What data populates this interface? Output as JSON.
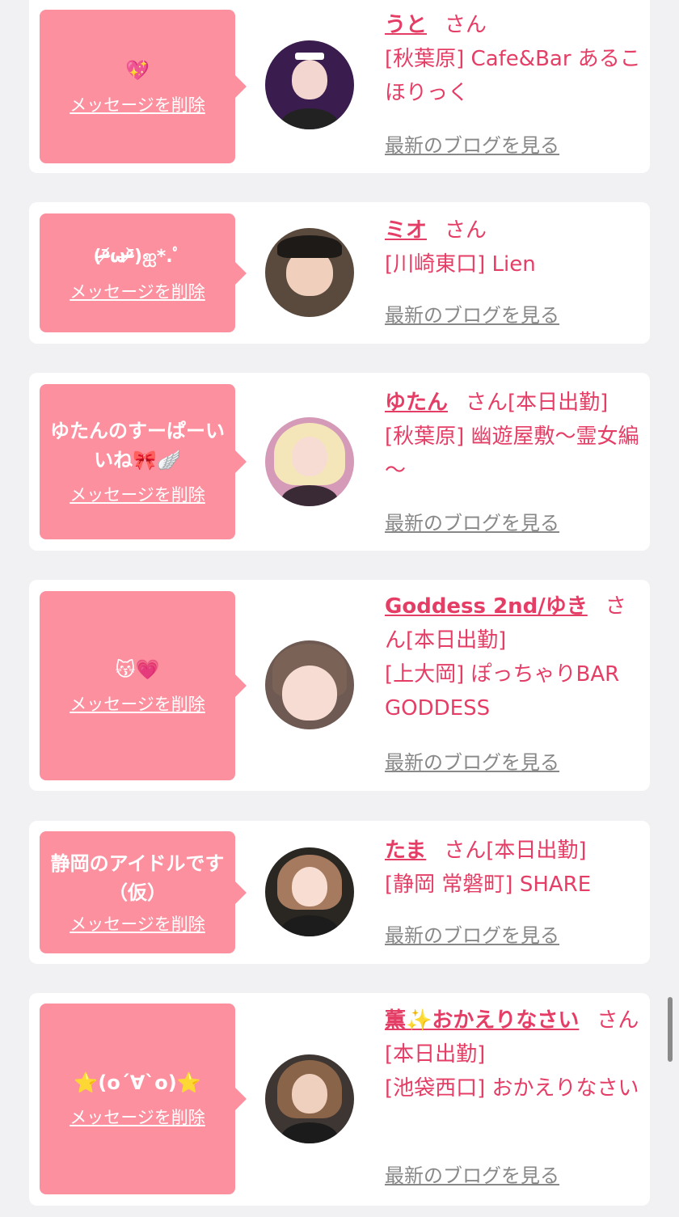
{
  "colors": {
    "accent": "#e53e66",
    "bubble": "#fc909f",
    "blog_link": "#888888",
    "background": "#f1f1f3"
  },
  "delete_label": "メッセージを削除",
  "blog_label": "最新のブログを見る",
  "san_label": "さん",
  "items": [
    {
      "message": "💖",
      "name": "うと",
      "status": "",
      "shop": "[秋葉原] Cafe&Bar あるこほりっく",
      "avatar_icon": "girl-maid-photo"
    },
    {
      "message": "(ᵒ̴̶̷᷄ωᵒ̴̶̷᷅)ஐ*.ﾟ",
      "name": "ミオ",
      "status": "",
      "shop": "[川崎東口] Lien",
      "avatar_icon": "girl-photo"
    },
    {
      "message": "ゆたんのすーぱーいいね🎀🪽",
      "name": "ゆたん",
      "status": "[本日出勤]",
      "shop": "[秋葉原] 幽遊屋敷～霊女編～",
      "avatar_icon": "girl-blonde-photo"
    },
    {
      "message": "😽💗",
      "name": "Goddess 2nd/ゆき",
      "status": "[本日出勤]",
      "shop": "[上大岡] ぽっちゃりBAR GODDESS",
      "avatar_icon": "girl-closeup-photo"
    },
    {
      "message": "静岡のアイドルです（仮）",
      "name": "たま",
      "status": "[本日出勤]",
      "shop": "[静岡 常磐町] SHARE",
      "avatar_icon": "girl-idol-photo"
    },
    {
      "message": "⭐(o´∀`o)⭐",
      "name": "薫✨おかえりなさい",
      "status": "[本日出勤]",
      "shop": "[池袋西口] おかえりなさい",
      "avatar_icon": "girl-lace-photo"
    }
  ]
}
